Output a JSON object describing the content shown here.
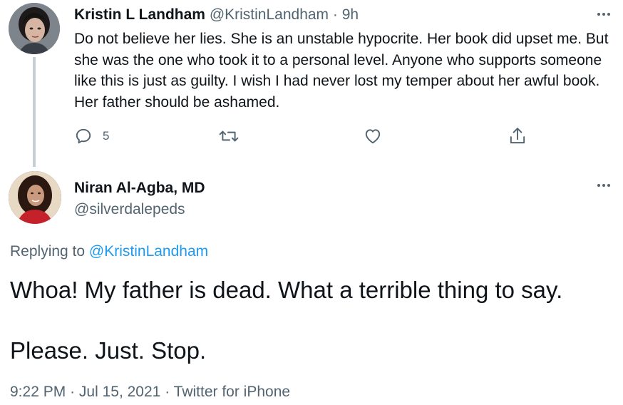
{
  "parent_tweet": {
    "display_name": "Kristin L Landham",
    "handle": "@KristinLandham",
    "separator": "·",
    "time_ago": "9h",
    "text": "Do not believe her lies. She is an unstable hypocrite. Her book did upset me. But she was the one who took it to a personal level. Anyone who supports someone like this is just as guilty. I wish I had never lost my temper about her awful book. Her father should be ashamed.",
    "reply_count": "5",
    "icons": {
      "reply": "reply-icon",
      "retweet": "retweet-icon",
      "like": "heart-icon",
      "share": "share-icon",
      "more": "more-icon"
    }
  },
  "main_tweet": {
    "display_name": "Niran Al-Agba, MD",
    "handle": "@silverdalepeds",
    "replying_prefix": "Replying to",
    "replying_to": "@KristinLandham",
    "text_line_1": "Whoa! My father is dead. What a terrible thing to say.",
    "text_line_2": "Please. Just. Stop.",
    "time": "9:22 PM",
    "separator": "·",
    "date": "Jul 15, 2021",
    "source": "Twitter for iPhone"
  },
  "colors": {
    "text_primary": "#0f1419",
    "text_secondary": "#536471",
    "link": "#1d9bf0",
    "thread_line": "#c4cfd6"
  }
}
